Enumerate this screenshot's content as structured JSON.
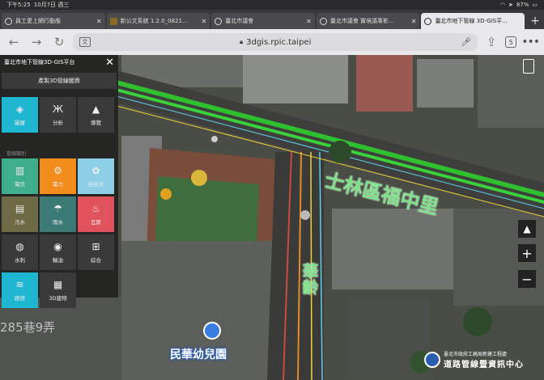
{
  "status_bar": {
    "time": "下午5:25",
    "date": "10月7日 週三",
    "battery": "87%"
  },
  "tabs": [
    {
      "title": "員工愛上網行動版",
      "active": false
    },
    {
      "title": "新公文系統 1.2.0_0821...",
      "active": false
    },
    {
      "title": "臺北市議會",
      "active": false
    },
    {
      "title": "臺北市議會 實境議事影...",
      "active": false
    },
    {
      "title": "臺北市地下管線 3D-GIS平...",
      "active": true
    }
  ],
  "toolbar": {
    "url": "3dgis.rpic.taipei",
    "translate_label": "文",
    "tab_count": "5"
  },
  "panel": {
    "title": "臺北市地下管線3D-GIS平台",
    "generate_button": "產製3D管線圖資",
    "tools": [
      {
        "label": "圖層",
        "icon": "layers-icon",
        "glyph": "◈",
        "color": "blue"
      },
      {
        "label": "分析",
        "icon": "compass-icon",
        "glyph": "Ж",
        "color": "dark"
      },
      {
        "label": "導覽",
        "icon": "navigate-icon",
        "glyph": "▲",
        "color": "dark"
      }
    ],
    "section_label": "管線類別",
    "pipes": [
      {
        "label": "電信",
        "icon": "telecom-icon",
        "glyph": "▥",
        "color": "green"
      },
      {
        "label": "電力",
        "icon": "power-icon",
        "glyph": "⚙",
        "color": "orange"
      },
      {
        "label": "自來水",
        "icon": "water-icon",
        "glyph": "✿",
        "color": "lightblue"
      },
      {
        "label": "污水",
        "icon": "sewage-icon",
        "glyph": "▤",
        "color": "olive"
      },
      {
        "label": "雨水",
        "icon": "rain-icon",
        "glyph": "☂",
        "color": "teal"
      },
      {
        "label": "瓦斯",
        "icon": "gas-icon",
        "glyph": "♨",
        "color": "red"
      },
      {
        "label": "水利",
        "icon": "hydraulic-icon",
        "glyph": "◍",
        "color": "dark"
      },
      {
        "label": "輸油",
        "icon": "oil-icon",
        "glyph": "◉",
        "color": "dark"
      },
      {
        "label": "綜合",
        "icon": "combined-icon",
        "glyph": "⊞",
        "color": "dark"
      },
      {
        "label": "路燈",
        "icon": "streetlight-icon",
        "glyph": "≋",
        "color": "blue"
      },
      {
        "label": "3D建物",
        "icon": "building-icon",
        "glyph": "▦",
        "color": "dark"
      }
    ]
  },
  "map": {
    "road_label": "士林區福中里",
    "street_label": "華齡",
    "lane_label": "285巷9弄",
    "poi_label": "民華幼兒園"
  },
  "logo": {
    "line1": "臺北市政府工務局新建工程處",
    "line2": "道路管線暨資訊中心"
  }
}
